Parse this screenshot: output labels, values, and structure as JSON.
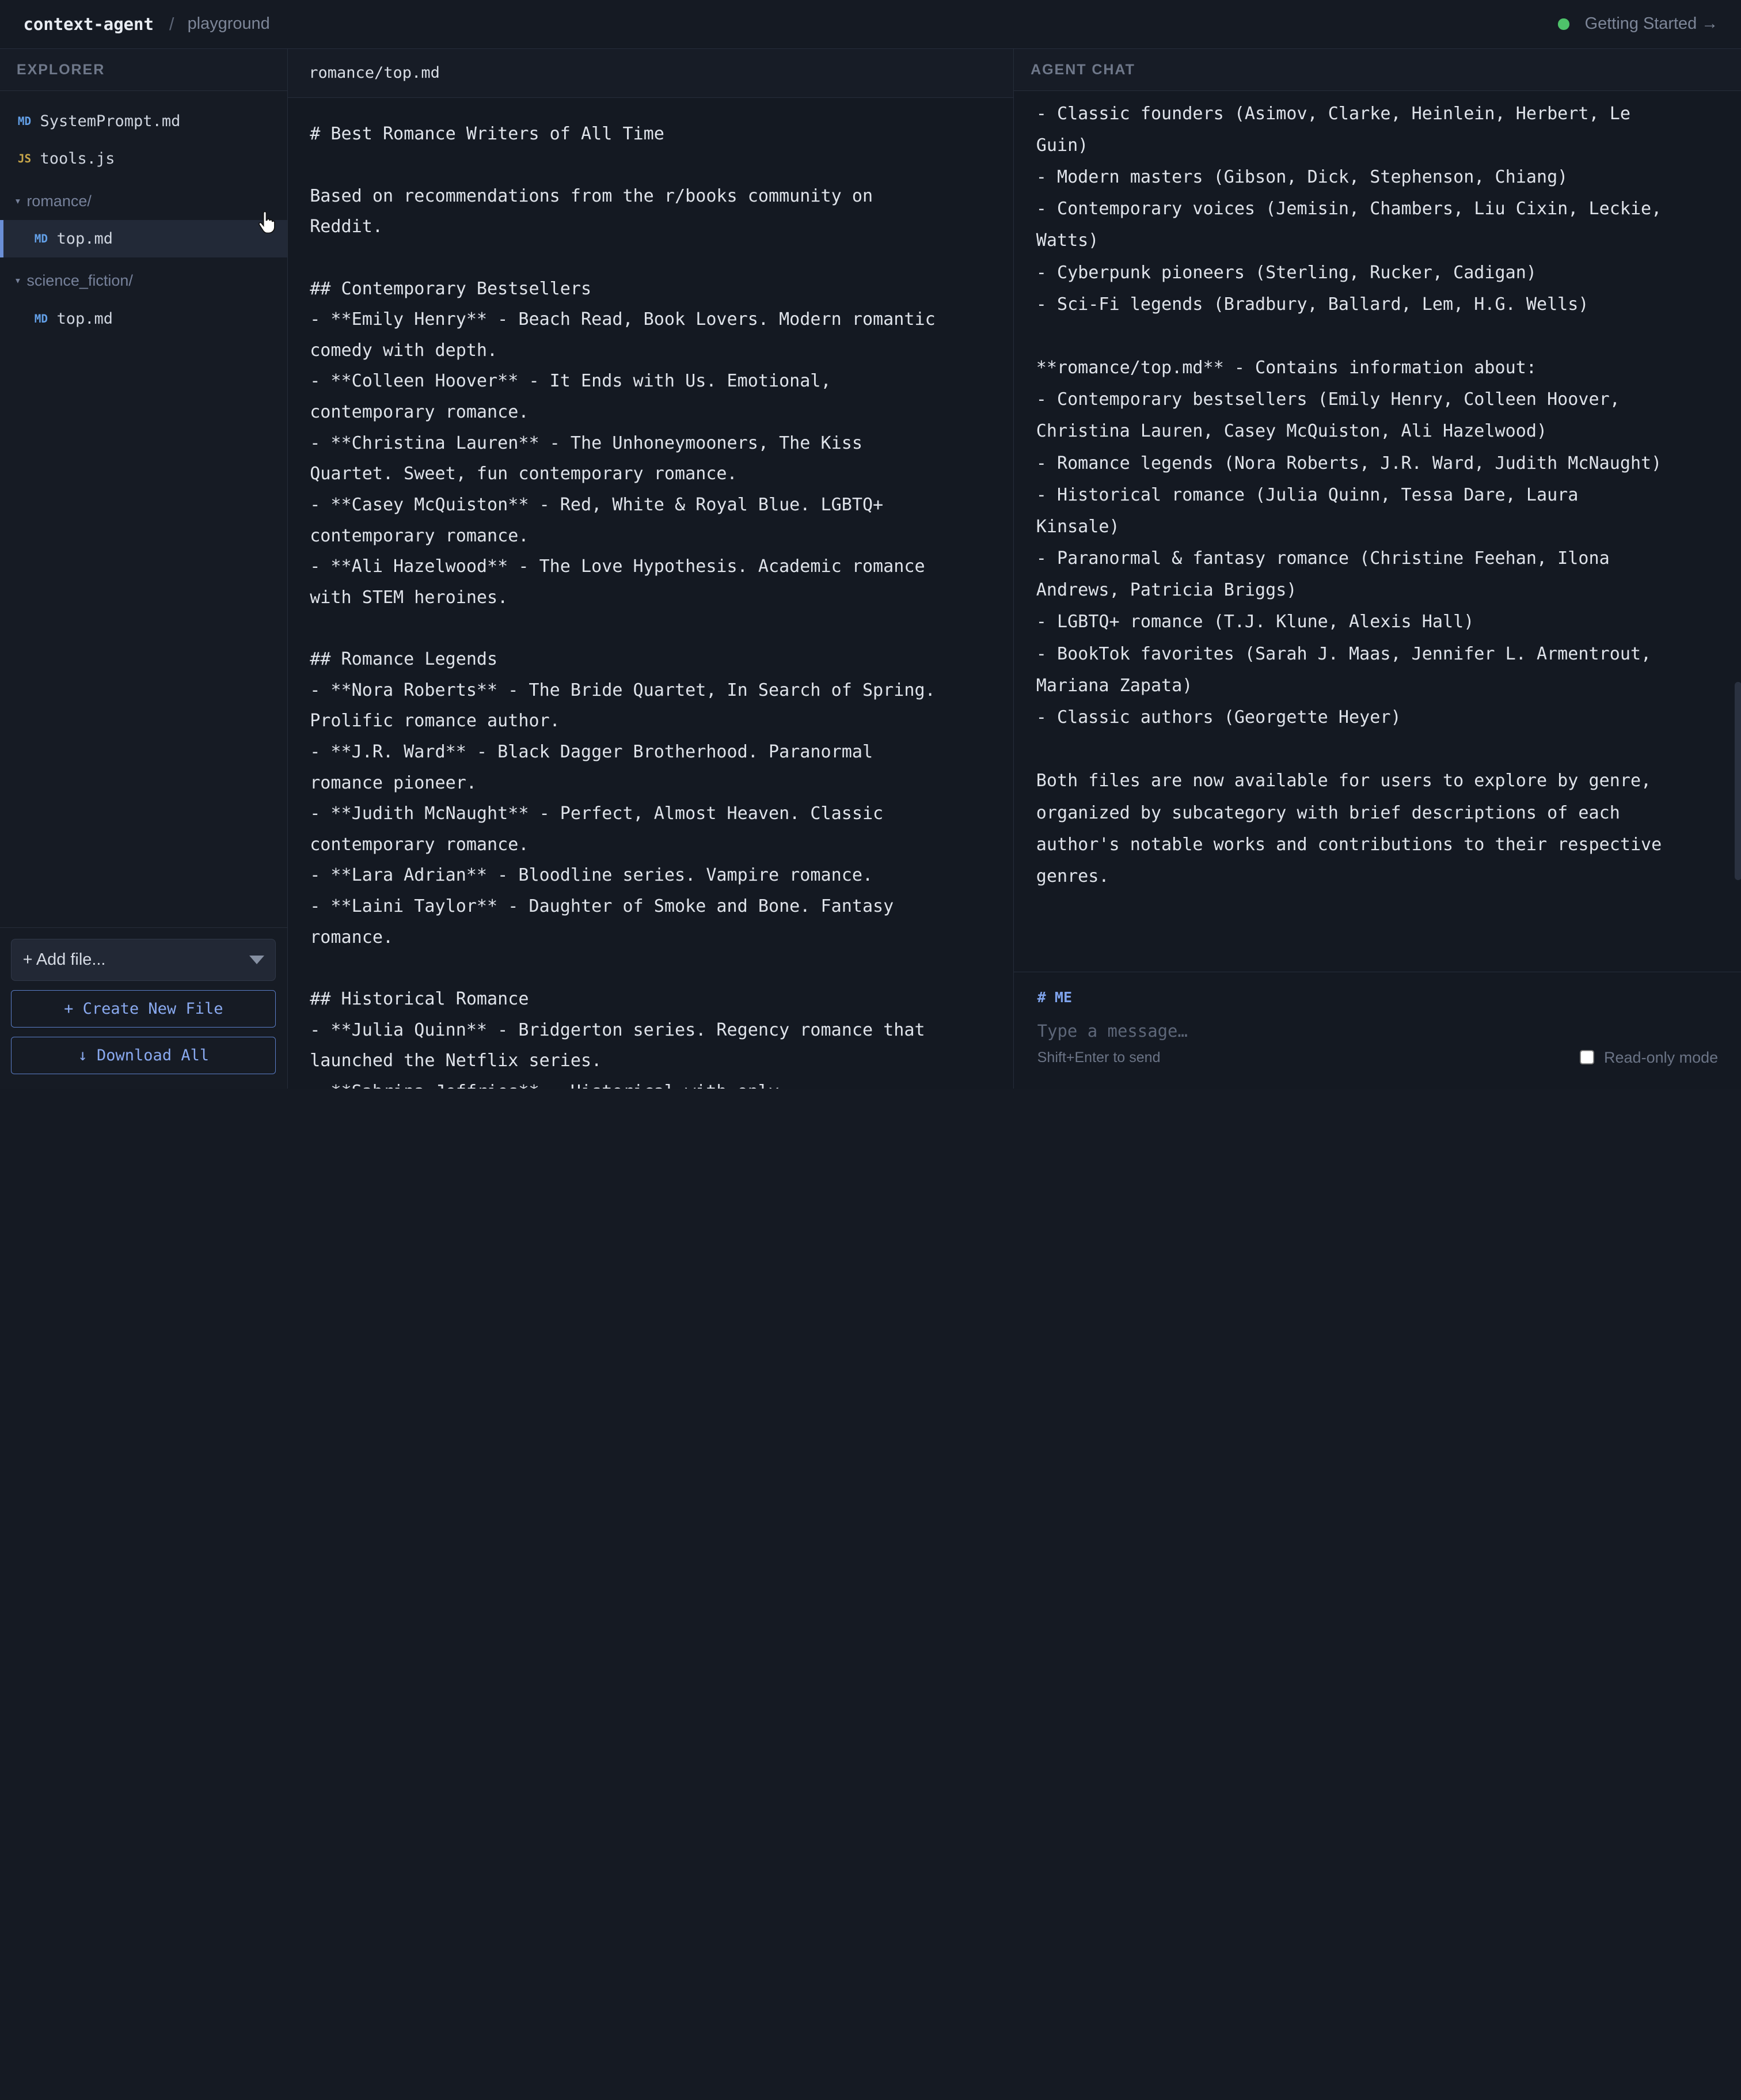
{
  "topbar": {
    "brand": "context-agent",
    "separator": "/",
    "crumb": "playground",
    "getting_started": "Getting Started →",
    "status_color": "#4ec26a"
  },
  "explorer": {
    "title": "EXPLORER",
    "items": [
      {
        "badge": "MD",
        "label": "SystemPrompt.md"
      },
      {
        "badge": "JS",
        "label": "tools.js"
      }
    ],
    "folders": [
      {
        "label": "romance/",
        "caret": "▾",
        "child_badge": "MD",
        "child_label": "top.md"
      },
      {
        "label": "science_fiction/",
        "caret": "▾",
        "child_badge": "MD",
        "child_label": "top.md"
      }
    ],
    "add_file": "+ Add file...",
    "create_button": "+ Create New File",
    "download_button": "↓ Download All"
  },
  "editor": {
    "path": "romance/top.md",
    "lines": [
      "# Best Romance Writers of All Time",
      "",
      "Based on recommendations from the r/books community on",
      "Reddit.",
      "",
      "## Contemporary Bestsellers",
      "- **Emily Henry** - Beach Read, Book Lovers. Modern romantic",
      "comedy with depth.",
      "- **Colleen Hoover** - It Ends with Us. Emotional,",
      "contemporary romance.",
      "- **Christina Lauren** - The Unhoneymooners, The Kiss",
      "Quartet. Sweet, fun contemporary romance.",
      "- **Casey McQuiston** - Red, White & Royal Blue. LGBTQ+",
      "contemporary romance.",
      "- **Ali Hazelwood** - The Love Hypothesis. Academic romance",
      "with STEM heroines.",
      "",
      "## Romance Legends",
      "- **Nora Roberts** - The Bride Quartet, In Search of Spring.",
      "Prolific romance author.",
      "- **J.R. Ward** - Black Dagger Brotherhood. Paranormal",
      "romance pioneer.",
      "- **Judith McNaught** - Perfect, Almost Heaven. Classic",
      "contemporary romance.",
      "- **Lara Adrian** - Bloodline series. Vampire romance.",
      "- **Laini Taylor** - Daughter of Smoke and Bone. Fantasy",
      "romance.",
      "",
      "## Historical Romance",
      "- **Julia Quinn** - Bridgerton series. Regency romance that",
      "launched the Netflix series.",
      "- **Sabrina Jeffries** - Historical with only"
    ]
  },
  "chat": {
    "title": "AGENT CHAT",
    "lines": [
      "- Classic founders (Asimov, Clarke, Heinlein, Herbert, Le",
      "Guin)",
      "- Modern masters (Gibson, Dick, Stephenson, Chiang)",
      "- Contemporary voices (Jemisin, Chambers, Liu Cixin, Leckie,",
      "Watts)",
      "- Cyberpunk pioneers (Sterling, Rucker, Cadigan)",
      "- Sci-Fi legends (Bradbury, Ballard, Lem, H.G. Wells)",
      "",
      "**romance/top.md** - Contains information about:",
      "- Contemporary bestsellers (Emily Henry, Colleen Hoover,",
      "Christina Lauren, Casey McQuiston, Ali Hazelwood)",
      "- Romance legends (Nora Roberts, J.R. Ward, Judith McNaught)",
      "- Historical romance (Julia Quinn, Tessa Dare, Laura",
      "Kinsale)",
      "- Paranormal & fantasy romance (Christine Feehan, Ilona",
      "Andrews, Patricia Briggs)",
      "- LGBTQ+ romance (T.J. Klune, Alexis Hall)",
      "- BookTok favorites (Sarah J. Maas, Jennifer L. Armentrout,",
      "Mariana Zapata)",
      "- Classic authors (Georgette Heyer)",
      "",
      "Both files are now available for users to explore by genre,",
      "organized by subcategory with brief descriptions of each",
      "author's notable works and contributions to their respective",
      "genres."
    ],
    "me_label": "# ME",
    "input_placeholder": "Type a message…",
    "send_hint": "Shift+Enter to send",
    "readonly_label": "Read-only mode"
  }
}
